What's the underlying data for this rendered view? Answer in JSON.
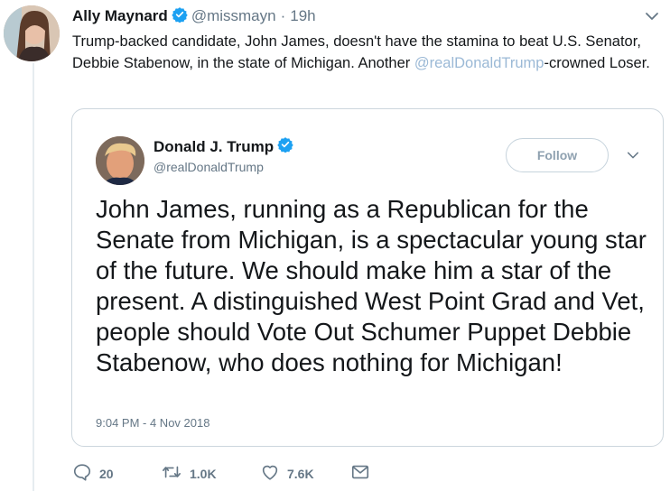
{
  "tweet": {
    "author_name": "Ally Maynard",
    "author_handle": "@missmayn",
    "separator": "·",
    "time": "19h",
    "text_before": "Trump-backed candidate, John James, doesn't have the stamina to beat U.S. Senator, Debbie Stabenow, in the state of Michigan. Another ",
    "mention": "@realDonaldTrump",
    "text_after": "-crowned Loser."
  },
  "quote": {
    "author_name": "Donald J. Trump",
    "author_handle": "@realDonaldTrump",
    "follow_label": "Follow",
    "text": "John James, running as a Republican for the Senate from Michigan, is a spectacular young star of the future. We should make him a star of the present. A distinguished West Point Grad and Vet, people should Vote Out Schumer Puppet Debbie Stabenow, who does nothing for Michigan!",
    "timestamp": "9:04 PM - 4 Nov 2018"
  },
  "actions": {
    "reply_count": "20",
    "retweet_count": "1.0K",
    "like_count": "7.6K"
  },
  "icons": {
    "verified": "verified-badge-icon",
    "caret": "chevron-down-icon",
    "reply": "reply-icon",
    "retweet": "retweet-icon",
    "like": "heart-icon",
    "message": "envelope-icon"
  },
  "colors": {
    "verified": "#1da1f2",
    "mention": "#9bb9d6",
    "secondary_text": "#657786",
    "border": "#ccd6dd"
  }
}
